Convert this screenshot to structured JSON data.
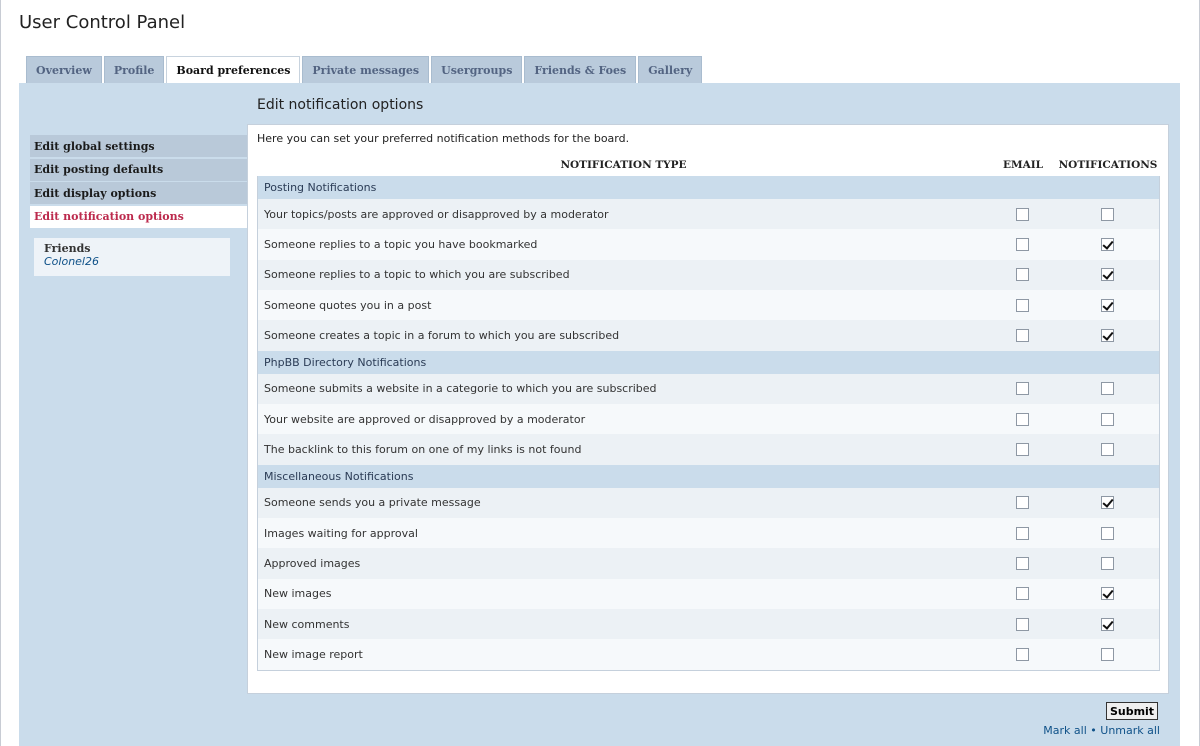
{
  "header": {
    "title": "User Control Panel"
  },
  "tabs": [
    {
      "label": "Overview",
      "active": false
    },
    {
      "label": "Profile",
      "active": false
    },
    {
      "label": "Board preferences",
      "active": true
    },
    {
      "label": "Private messages",
      "active": false
    },
    {
      "label": "Usergroups",
      "active": false
    },
    {
      "label": "Friends & Foes",
      "active": false
    },
    {
      "label": "Gallery",
      "active": false
    }
  ],
  "sidebar": {
    "items": [
      {
        "label": "Edit global settings",
        "active": false
      },
      {
        "label": "Edit posting defaults",
        "active": false
      },
      {
        "label": "Edit display options",
        "active": false
      },
      {
        "label": "Edit notification options",
        "active": true
      }
    ],
    "friends": {
      "title": "Friends",
      "names": [
        "Colonel26"
      ]
    }
  },
  "main": {
    "title": "Edit notification options",
    "intro": "Here you can set your preferred notification methods for the board.",
    "columns": {
      "type": "NOTIFICATION TYPE",
      "email": "EMAIL",
      "notifications": "NOTIFICATIONS"
    },
    "groups": [
      {
        "name": "Posting Notifications",
        "rows": [
          {
            "label": "Your topics/posts are approved or disapproved by a moderator",
            "email": false,
            "notifications": false
          },
          {
            "label": "Someone replies to a topic you have bookmarked",
            "email": false,
            "notifications": true
          },
          {
            "label": "Someone replies to a topic to which you are subscribed",
            "email": false,
            "notifications": true
          },
          {
            "label": "Someone quotes you in a post",
            "email": false,
            "notifications": true
          },
          {
            "label": "Someone creates a topic in a forum to which you are subscribed",
            "email": false,
            "notifications": true
          }
        ]
      },
      {
        "name": "PhpBB Directory Notifications",
        "rows": [
          {
            "label": "Someone submits a website in a categorie to which you are subscribed",
            "email": false,
            "notifications": false
          },
          {
            "label": "Your website are approved or disapproved by a moderator",
            "email": false,
            "notifications": false
          },
          {
            "label": "The backlink to this forum on one of my links is not found",
            "email": false,
            "notifications": false
          }
        ]
      },
      {
        "name": "Miscellaneous Notifications",
        "rows": [
          {
            "label": "Someone sends you a private message",
            "email": false,
            "notifications": true
          },
          {
            "label": "Images waiting for approval",
            "email": false,
            "notifications": false
          },
          {
            "label": "Approved images",
            "email": false,
            "notifications": false
          },
          {
            "label": "New images",
            "email": false,
            "notifications": true
          },
          {
            "label": "New comments",
            "email": false,
            "notifications": true
          },
          {
            "label": "New image report",
            "email": false,
            "notifications": false
          }
        ]
      }
    ]
  },
  "actions": {
    "submit": "Submit",
    "mark_all": "Mark all",
    "separator": "•",
    "unmark_all": "Unmark all"
  }
}
